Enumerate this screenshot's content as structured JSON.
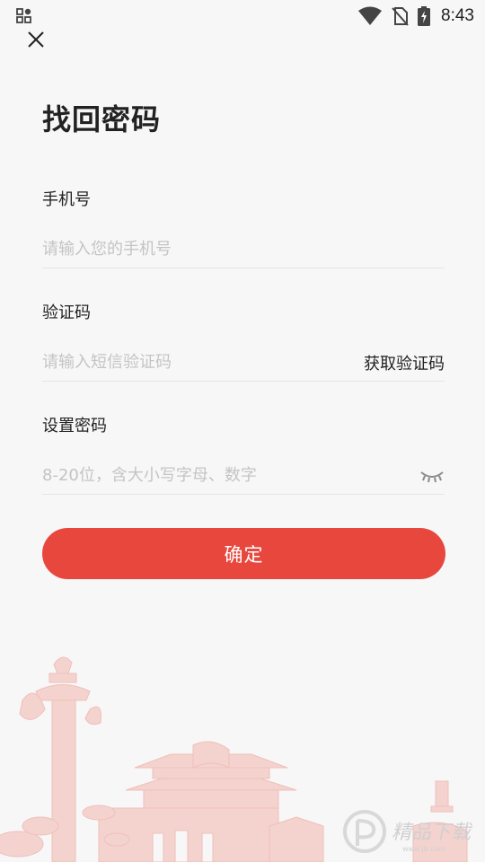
{
  "status_bar": {
    "time": "8:43",
    "icons": [
      "notification-grid-icon",
      "wifi-icon",
      "no-sim-icon",
      "battery-charging-icon"
    ]
  },
  "header": {
    "close_icon": "close-icon",
    "title": "找回密码"
  },
  "form": {
    "phone": {
      "label": "手机号",
      "placeholder": "请输入您的手机号",
      "value": ""
    },
    "code": {
      "label": "验证码",
      "placeholder": "请输入短信验证码",
      "value": "",
      "get_code_label": "获取验证码"
    },
    "password": {
      "label": "设置密码",
      "placeholder": "8-20位，含大小写字母、数字",
      "value": "",
      "toggle_icon": "eye-closed-icon"
    },
    "confirm_label": "确定"
  },
  "colors": {
    "accent": "#e8473e",
    "background": "#f7f7f7",
    "placeholder": "#c4c4c4",
    "illustration": "#f2c9c5"
  },
  "watermark": {
    "brand": "精品下载",
    "url": "www.jb.com"
  }
}
